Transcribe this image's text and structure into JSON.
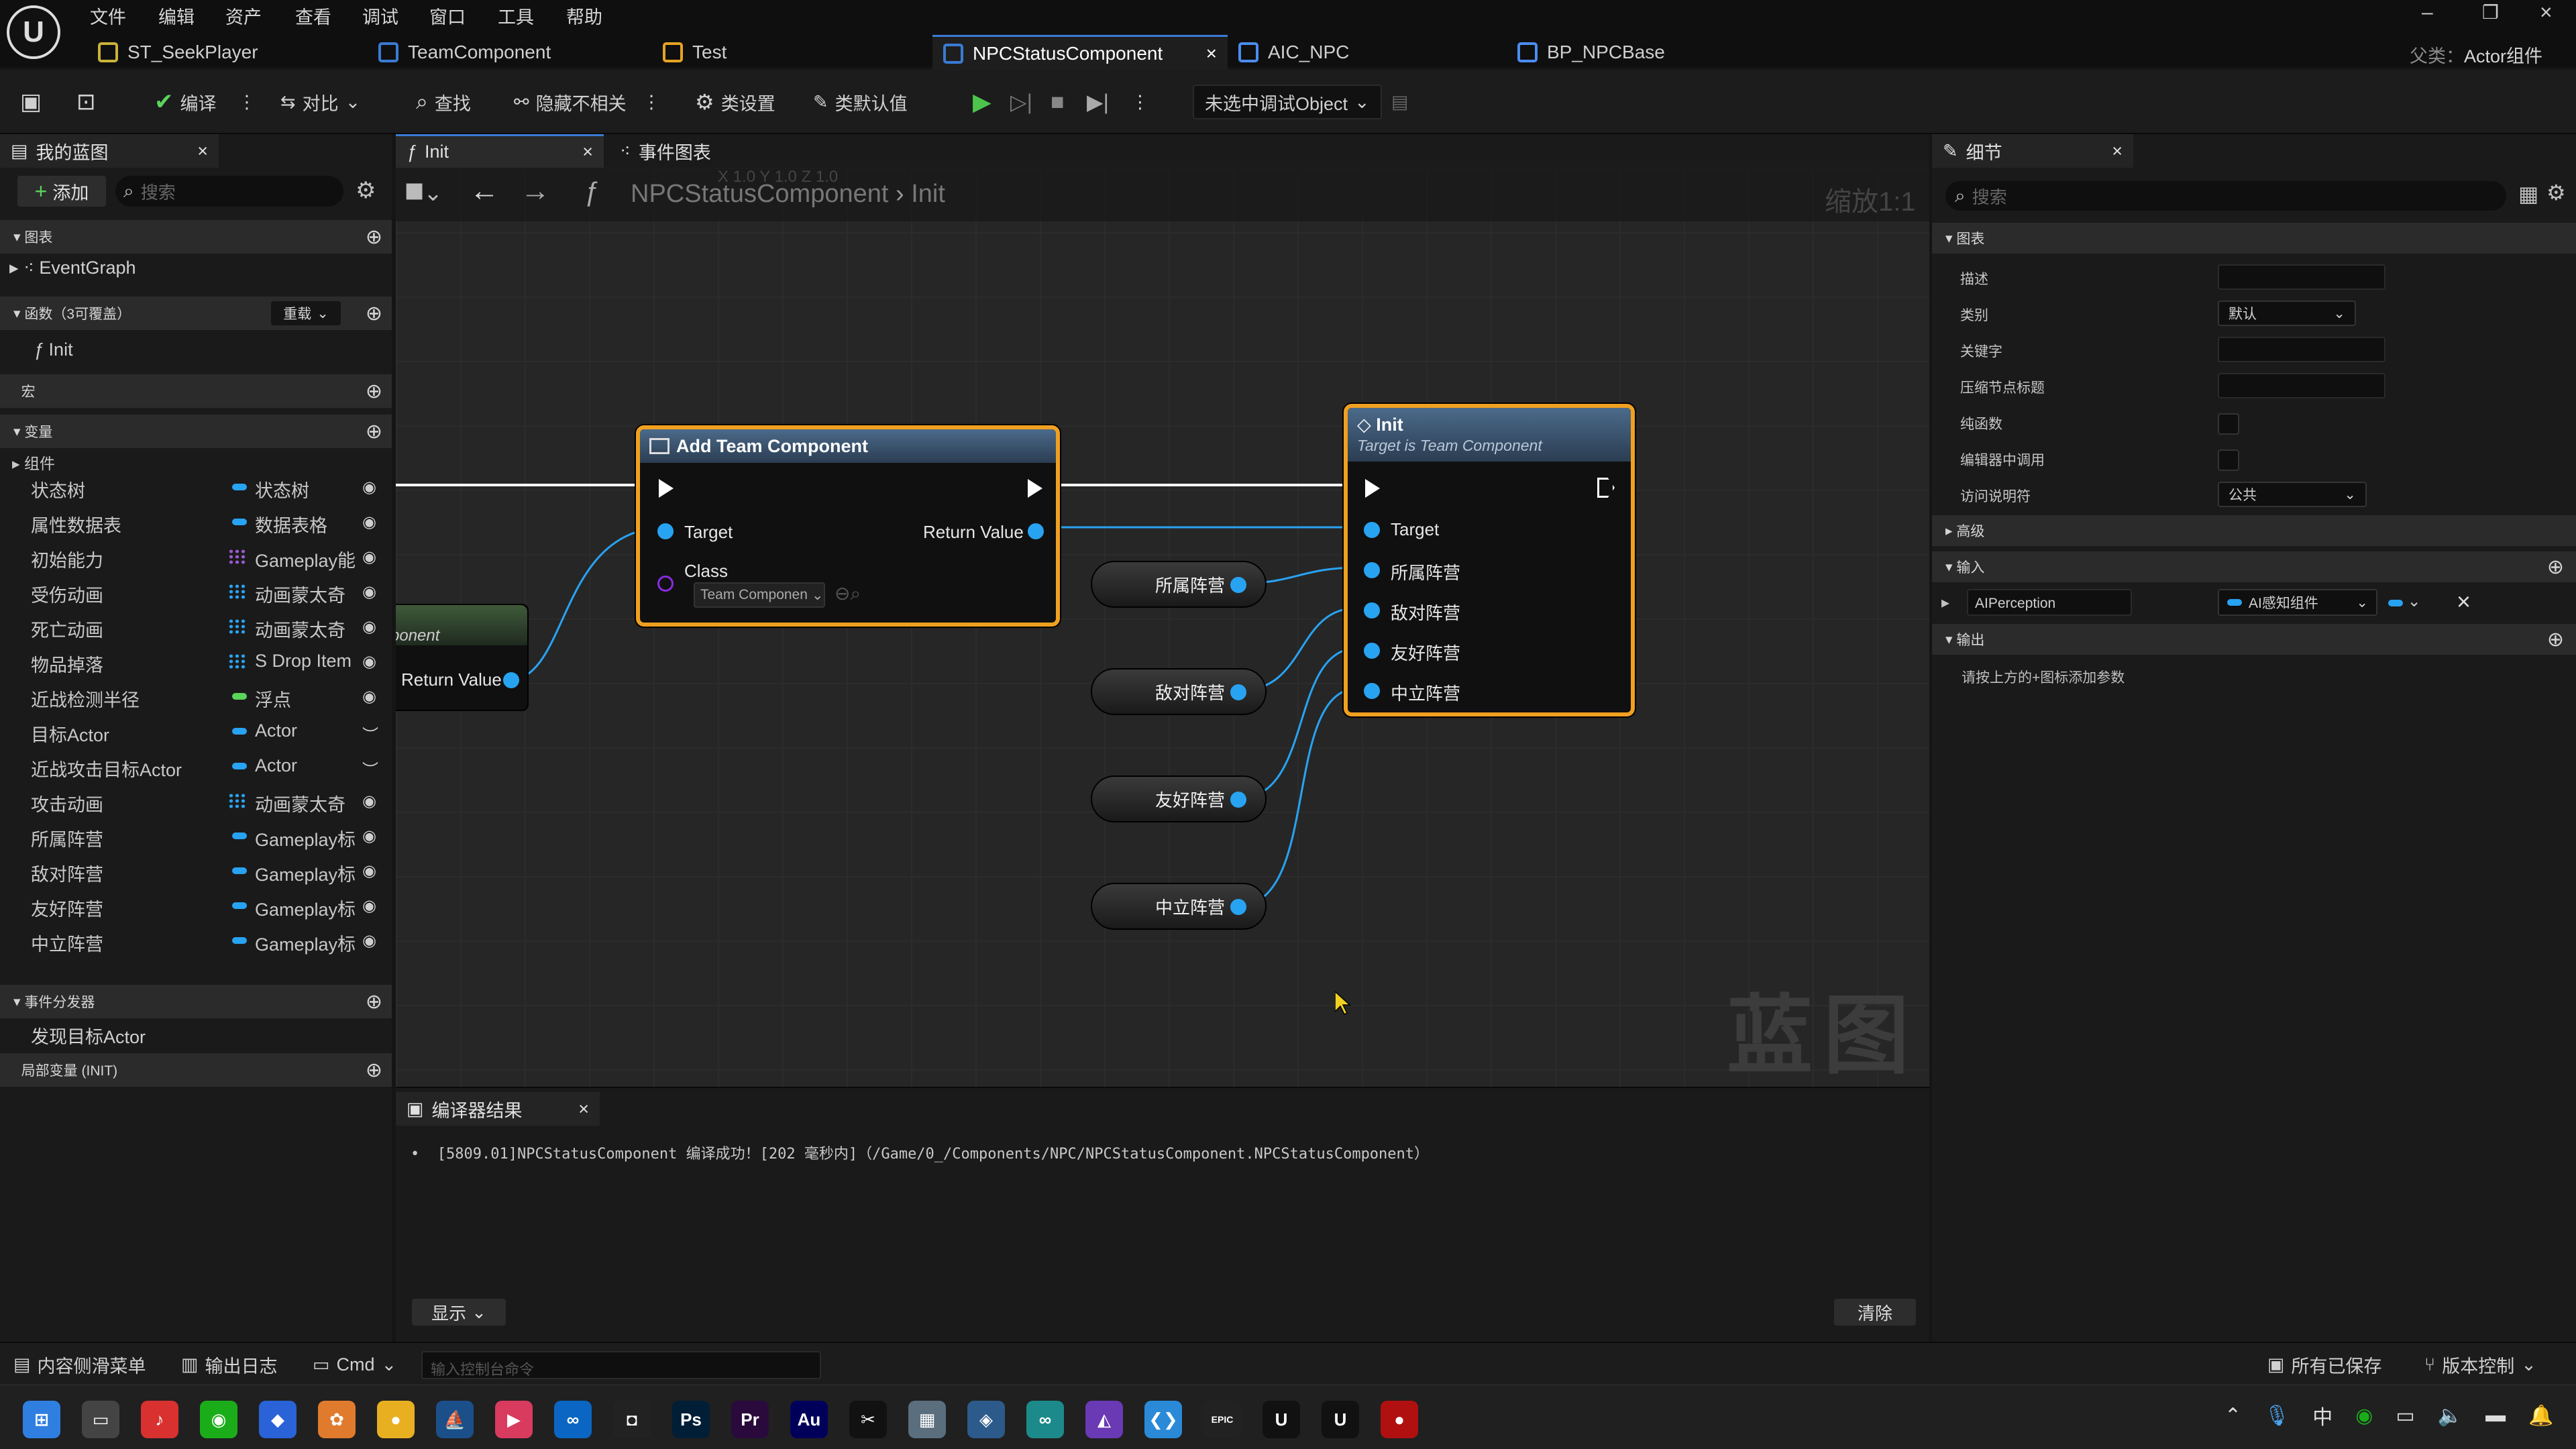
{
  "menu": [
    "文件",
    "编辑",
    "资产",
    "查看",
    "调试",
    "窗口",
    "工具",
    "帮助"
  ],
  "tabs": [
    {
      "label": "ST_SeekPlayer",
      "color": "#c8b23a"
    },
    {
      "label": "TeamComponent",
      "color": "#3a7bd5"
    },
    {
      "label": "Test",
      "color": "#e6a323"
    },
    {
      "label": "NPCStatusComponent",
      "color": "#3a7bd5",
      "active": true,
      "close": "×"
    },
    {
      "label": "AIC_NPC",
      "color": "#4a8df0"
    },
    {
      "label": "BP_NPCBase",
      "color": "#4a8df0"
    }
  ],
  "parent_class": {
    "label": "父类：",
    "value": "Actor组件"
  },
  "toolbar": {
    "compile": "编译",
    "diff": "对比",
    "find": "查找",
    "hide_unrelated": "隐藏不相关",
    "class_settings": "类设置",
    "class_defaults": "类默认值",
    "debug_select": "未选中调试Object"
  },
  "my_blueprint": {
    "title": "我的蓝图",
    "add": "添加",
    "search_placeholder": "搜索",
    "graphs_header": "图表",
    "event_graph": "EventGraph",
    "functions_header": "函数（3可覆盖）",
    "override": "重载",
    "function_item": "Init",
    "macros_header": "宏",
    "variables_header": "变量",
    "components": "组件",
    "variables": [
      {
        "name": "状态树",
        "type": "状态树",
        "color": "#28a3f2",
        "icon": "pill",
        "vis": "eye"
      },
      {
        "name": "属性数据表",
        "type": "数据表格",
        "color": "#28a3f2",
        "icon": "pill",
        "vis": "eye"
      },
      {
        "name": "初始能力",
        "type": "Gameplay能",
        "color": "#9b59d0",
        "icon": "grid",
        "vis": "eye"
      },
      {
        "name": "受伤动画",
        "type": "动画蒙太奇",
        "color": "#28a3f2",
        "icon": "grid",
        "vis": "eye"
      },
      {
        "name": "死亡动画",
        "type": "动画蒙太奇",
        "color": "#28a3f2",
        "icon": "grid",
        "vis": "eye"
      },
      {
        "name": "物品掉落",
        "type": "S Drop Item",
        "color": "#28a3f2",
        "icon": "grid",
        "vis": "eye"
      },
      {
        "name": "近战检测半径",
        "type": "浮点",
        "color": "#5bd45b",
        "icon": "pill",
        "vis": "eye"
      },
      {
        "name": "目标Actor",
        "type": "Actor",
        "color": "#28a3f2",
        "icon": "pill",
        "vis": "closed"
      },
      {
        "name": "近战攻击目标Actor",
        "type": "Actor",
        "color": "#28a3f2",
        "icon": "pill",
        "vis": "closed"
      },
      {
        "name": "攻击动画",
        "type": "动画蒙太奇",
        "color": "#28a3f2",
        "icon": "grid",
        "vis": "eye"
      },
      {
        "name": "所属阵营",
        "type": "Gameplay标",
        "color": "#28a3f2",
        "icon": "pill",
        "vis": "eye"
      },
      {
        "name": "敌对阵营",
        "type": "Gameplay标",
        "color": "#28a3f2",
        "icon": "pill",
        "vis": "eye"
      },
      {
        "name": "友好阵营",
        "type": "Gameplay标",
        "color": "#28a3f2",
        "icon": "pill",
        "vis": "eye"
      },
      {
        "name": "中立阵营",
        "type": "Gameplay标",
        "color": "#28a3f2",
        "icon": "pill",
        "vis": "eye"
      }
    ],
    "dispatchers_header": "事件分发器",
    "dispatcher_item": "发现目标Actor",
    "locals_header": "局部变量 (INIT)"
  },
  "graph_tabs": {
    "init": "Init",
    "event_graph": "事件图表"
  },
  "breadcrumb": {
    "root": "NPCStatusComponent",
    "sep": "›",
    "leaf": "Init"
  },
  "zoom": "缩放1:1",
  "watermark": "蓝图",
  "faded_text": "X 1.0 Y 1.0 Z 1.0",
  "nodes": {
    "add_team": {
      "title": "Add Team Component",
      "target": "Target",
      "return": "Return Value",
      "class_label": "Class",
      "class_value": "Team Componen"
    },
    "init": {
      "title": "Init",
      "subtitle": "Target is Team Component",
      "target": "Target",
      "pins": [
        "所属阵营",
        "敌对阵营",
        "友好阵营",
        "中立阵营"
      ]
    },
    "left_partial": {
      "title": "ponent",
      "return": "Return Value"
    },
    "vars": [
      "所属阵营",
      "敌对阵营",
      "友好阵营",
      "中立阵营"
    ]
  },
  "compiler": {
    "title": "编译器结果",
    "message": "[5809.01]NPCStatusComponent 编译成功！[202 毫秒内]（/Game/0_/Components/NPC/NPCStatusComponent.NPCStatusComponent）",
    "show": "显示",
    "clear": "清除"
  },
  "details": {
    "title": "细节",
    "search_placeholder": "搜索",
    "graph_header": "图表",
    "rows": [
      {
        "label": "描述",
        "kind": "input"
      },
      {
        "label": "类别",
        "kind": "select",
        "value": "默认"
      },
      {
        "label": "关键字",
        "kind": "input"
      },
      {
        "label": "压缩节点标题",
        "kind": "input"
      },
      {
        "label": "纯函数",
        "kind": "check"
      },
      {
        "label": "编辑器中调用",
        "kind": "check"
      },
      {
        "label": "访问说明符",
        "kind": "select",
        "value": "公共"
      }
    ],
    "advanced": "高级",
    "inputs_header": "输入",
    "input_name": "AIPerception",
    "input_type": "AI感知组件",
    "outputs_header": "输出",
    "outputs_hint": "请按上方的+图标添加参数"
  },
  "statusbar": {
    "content_drawer": "内容侧滑菜单",
    "output_log": "输出日志",
    "cmd": "Cmd",
    "console_placeholder": "输入控制台命令",
    "all_saved": "所有已保存",
    "source_control": "版本控制"
  },
  "taskbar": {
    "tray_ime": "中",
    "icons": [
      "start-icon",
      "terminal-icon",
      "netease-music-icon",
      "wechat-icon",
      "app-icon",
      "butterfly-icon",
      "chrome-icon",
      "steam-icon",
      "app-icon",
      "meta-icon",
      "app-icon",
      "photoshop-icon",
      "premiere-icon",
      "audition-icon",
      "capcut-icon",
      "calculator-icon",
      "app-icon",
      "infinity-icon",
      "visual-studio-icon",
      "vscode-icon",
      "epic-games-icon",
      "unreal-icon",
      "unreal-icon",
      "record-icon"
    ],
    "icon_colors": [
      "#2f7fe0",
      "#444",
      "#d8312f",
      "#1aad19",
      "#2a62d8",
      "#e07b2e",
      "#e8b020",
      "#1b4f8a",
      "#d83b5e",
      "#0a66c2",
      "#222",
      "#001e36",
      "#2a0a3c",
      "#00005b",
      "#111",
      "#5a6e7e",
      "#2c5a8a",
      "#1c8a8a",
      "#6a3ab5",
      "#2a8ad8",
      "#222",
      "#111",
      "#111",
      "#b01010"
    ],
    "icon_glyphs": [
      "⊞",
      "▭",
      "♪",
      "◉",
      "◆",
      "✿",
      "●",
      "⛵",
      "▶",
      "∞",
      "◘",
      "Ps",
      "Pr",
      "Au",
      "✂",
      "▦",
      "◈",
      "∞",
      "◭",
      "❮❯",
      "EPIC",
      "U",
      "U",
      "●"
    ]
  }
}
